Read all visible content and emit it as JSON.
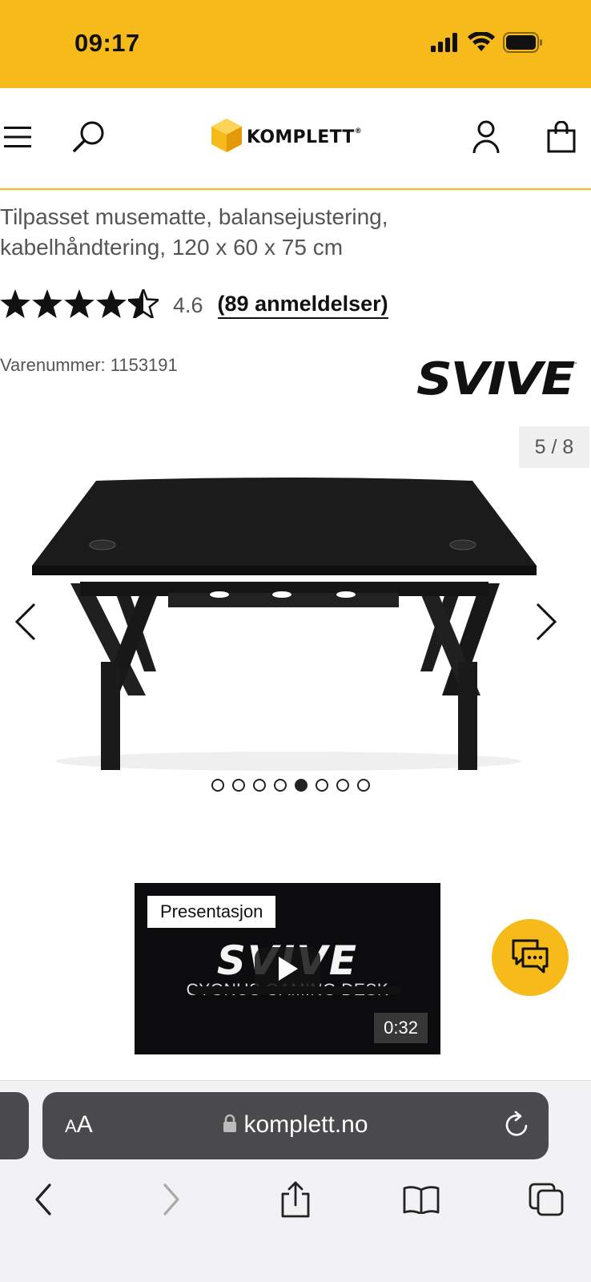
{
  "status_bar": {
    "time": "09:17",
    "icons": [
      "signal-icon",
      "wifi-icon",
      "battery-icon"
    ]
  },
  "header": {
    "brand": "KOMPLETT",
    "brand_mark": "®",
    "icons": [
      "menu-icon",
      "search-icon",
      "komplett-logo-icon",
      "account-icon",
      "cart-icon"
    ]
  },
  "product": {
    "subtitle_line1": "Tilpasset musematte, balansejustering,",
    "subtitle_line2": "kabelhåndtering, 120 x 60 x 75 cm",
    "rating": {
      "value": "4.6",
      "stars_filled": 4.5,
      "stars_total": 5,
      "reviews_label": "(89 anmeldelser)"
    },
    "sku": "Varenummer: 1153191",
    "brand_logo_text": "SVIVE"
  },
  "gallery": {
    "counter": "5 / 8",
    "total_images": 8,
    "active_index": 5,
    "icons": [
      "chevron-left-icon",
      "chevron-right-icon"
    ]
  },
  "video": {
    "label": "Presentasjon",
    "brand_text": "SVIVE",
    "caption": "CYGNUS GAMING DESK",
    "duration": "0:32"
  },
  "chat": {
    "icon": "chat-icon"
  },
  "browser": {
    "aa_small": "A",
    "aa_large": "A",
    "url": "komplett.no",
    "icons": [
      "lock-icon",
      "reload-icon",
      "back-icon",
      "forward-icon",
      "share-icon",
      "bookmarks-icon",
      "tabs-icon"
    ]
  },
  "colors": {
    "accent": "#f6bb1b",
    "text_dark": "#111111",
    "text_muted": "#555555"
  }
}
